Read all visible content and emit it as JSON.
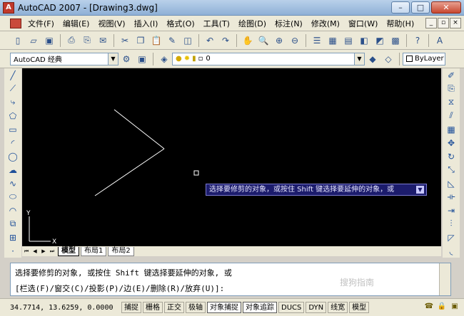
{
  "window": {
    "title": "AutoCAD 2007 - [Drawing3.dwg]",
    "minimize": "–",
    "maximize": "□",
    "close": "✕"
  },
  "menu": {
    "items": [
      "文件(F)",
      "编辑(E)",
      "视图(V)",
      "插入(I)",
      "格式(O)",
      "工具(T)",
      "绘图(D)",
      "标注(N)",
      "修改(M)",
      "窗口(W)",
      "帮助(H)"
    ]
  },
  "toolbar2": {
    "workspace": "AutoCAD 经典",
    "layer_value": "0",
    "bylayer": "ByLayer"
  },
  "canvas": {
    "tooltip": "选择要修剪的对象，或按住 Shift 键选择要延伸的对象，或",
    "ucs_y": "Y",
    "ucs_x": "X"
  },
  "layout_tabs": [
    "模型",
    "布局1",
    "布局2"
  ],
  "command": {
    "line1": "选择要修剪的对象, 或按住 Shift 键选择要延伸的对象, 或",
    "line2": "[栏选(F)/窗交(C)/投影(P)/边(E)/删除(R)/放弃(U)]:"
  },
  "status": {
    "coords": "34.7714, 13.6259, 0.0000",
    "buttons": [
      "捕捉",
      "栅格",
      "正交",
      "极轴",
      "对象捕捉",
      "对象追踪",
      "DUCS",
      "DYN",
      "线宽",
      "模型"
    ],
    "on_index": [
      4,
      5
    ]
  },
  "watermark": "搜狗指南"
}
